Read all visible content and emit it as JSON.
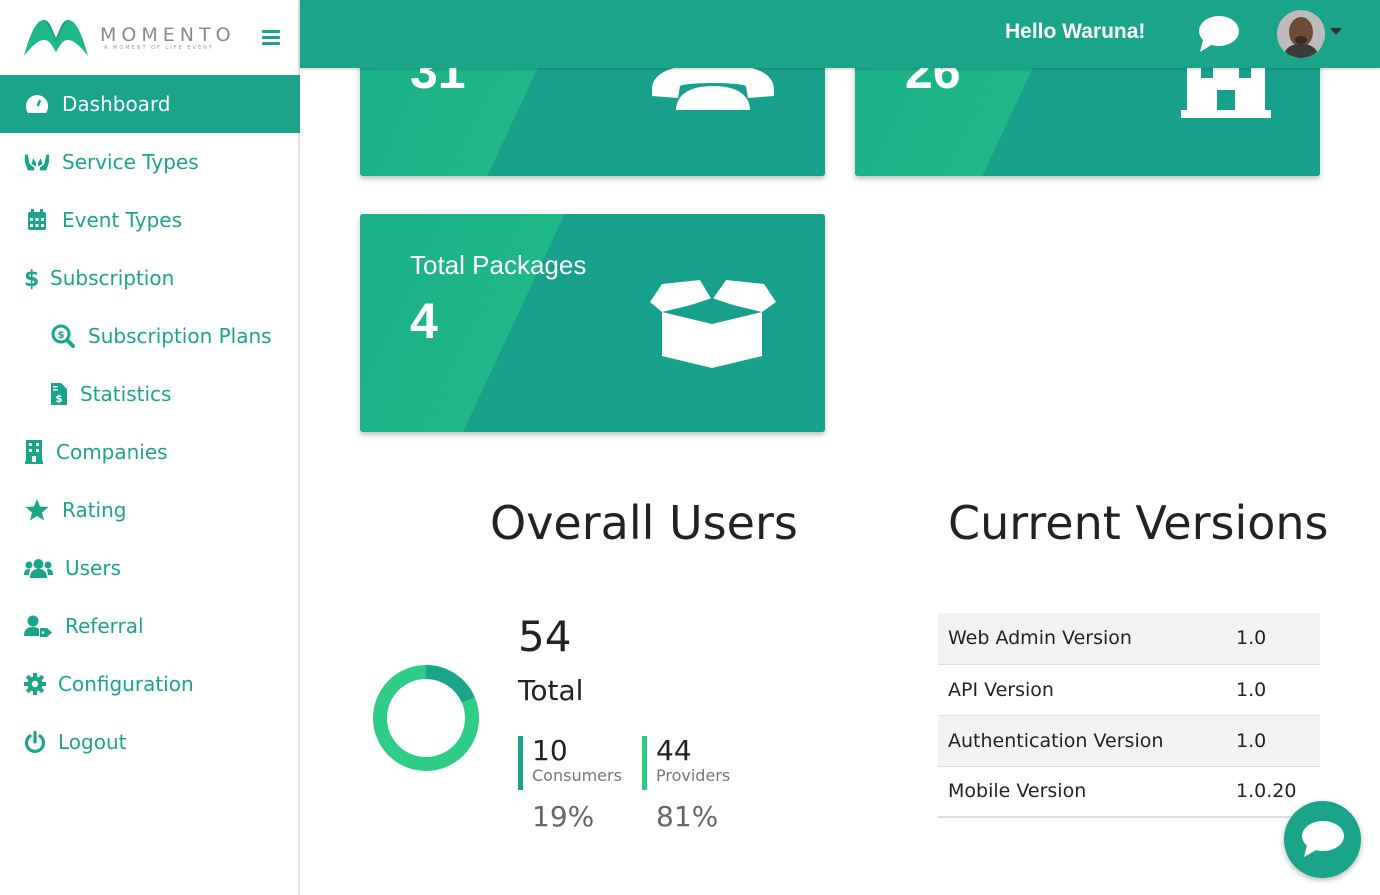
{
  "brand": {
    "name": "MOMENTO",
    "tagline": "A MOMENT OF LIFE EVENT",
    "color": "#1aa58a"
  },
  "header": {
    "greeting": "Hello Waruna!"
  },
  "sidebar": {
    "items": [
      {
        "label": "Dashboard",
        "icon": "dashboard-gauge-icon",
        "active": true
      },
      {
        "label": "Service Types",
        "icon": "hands-icon"
      },
      {
        "label": "Event Types",
        "icon": "calendar-icon"
      },
      {
        "label": "Subscription",
        "icon": "dollar-icon"
      },
      {
        "label": "Subscription Plans",
        "icon": "search-dollar-icon"
      },
      {
        "label": "Statistics",
        "icon": "invoice-dollar-icon"
      },
      {
        "label": "Companies",
        "icon": "building-icon"
      },
      {
        "label": "Rating",
        "icon": "star-icon"
      },
      {
        "label": "Users",
        "icon": "users-icon"
      },
      {
        "label": "Referral",
        "icon": "user-tag-icon"
      },
      {
        "label": "Configuration",
        "icon": "gear-icon"
      },
      {
        "label": "Logout",
        "icon": "power-icon"
      }
    ]
  },
  "cards": {
    "card1_value": "31",
    "card2_value": "26",
    "packages": {
      "title": "Total Packages",
      "value": "4"
    }
  },
  "overall_users": {
    "title": "Overall Users",
    "total_value": "54",
    "total_label": "Total",
    "consumers": {
      "value": "10",
      "label": "Consumers",
      "percent": "19%"
    },
    "providers": {
      "value": "44",
      "label": "Providers",
      "percent": "81%"
    },
    "colors": {
      "consumers": "#1aa58a",
      "providers": "#2ecc87"
    }
  },
  "versions": {
    "title": "Current Versions",
    "rows": [
      {
        "name": "Web Admin Version",
        "value": "1.0"
      },
      {
        "name": "API Version",
        "value": "1.0"
      },
      {
        "name": "Authentication Version",
        "value": "1.0"
      },
      {
        "name": "Mobile Version",
        "value": "1.0.20"
      }
    ]
  }
}
